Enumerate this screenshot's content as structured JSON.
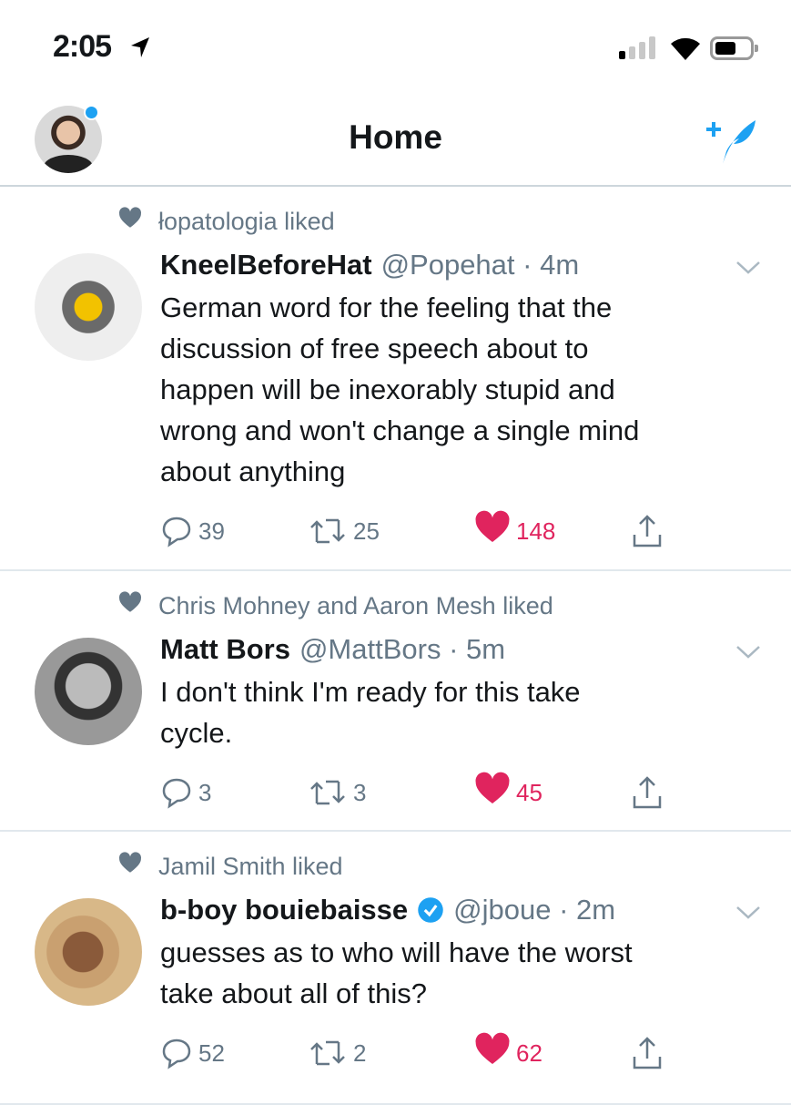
{
  "status_bar": {
    "time": "2:05"
  },
  "header": {
    "title": "Home"
  },
  "accent": "#1da1f2",
  "like_color": "#e0245e",
  "tweets": [
    {
      "liked_by": "łopatologia liked",
      "name": "KneelBeforeHat",
      "handle": "@Popehat · 4m",
      "verified": false,
      "lines": [
        "German word for the feeling that the",
        "discussion of free speech about to",
        "happen will be inexorably stupid and",
        "wrong and won't change a single mind",
        "about anything"
      ],
      "replies": "39",
      "retweets": "25",
      "likes": "148"
    },
    {
      "liked_by": "Chris Mohney and Aaron Mesh liked",
      "name": "Matt Bors",
      "handle": "@MattBors · 5m",
      "verified": false,
      "lines": [
        "I don't think I'm ready for this take",
        "cycle."
      ],
      "replies": "3",
      "retweets": "3",
      "likes": "45"
    },
    {
      "liked_by": "Jamil Smith liked",
      "name": "b-boy bouiebaisse",
      "handle": "@jboue · 2m",
      "verified": true,
      "lines": [
        "guesses as to who will have the worst",
        "take about all of this?"
      ],
      "replies": "52",
      "retweets": "2",
      "likes": "62"
    }
  ]
}
